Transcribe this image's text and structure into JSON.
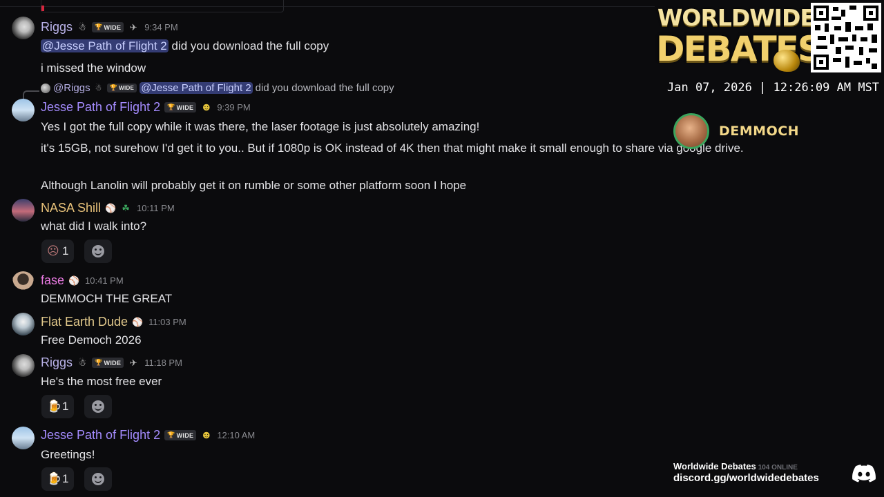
{
  "messages": {
    "m1": {
      "author": "Riggs",
      "time": "9:34 PM",
      "badge": "WIDE",
      "mention": "@Jesse Path of Flight 2",
      "line1": " did you download the full copy",
      "line2": "i missed the window"
    },
    "m2": {
      "reply": {
        "author": "@Riggs",
        "badge": "WIDE",
        "mention": "@Jesse Path of Flight 2",
        "text": " did you download the full copy"
      },
      "author": "Jesse Path of Flight 2",
      "badge": "WIDE",
      "time": "9:39 PM",
      "line1": "Yes I got the full copy while it was there, the laser footage is just absolutely amazing!",
      "line2": "it's 15GB, not surehow I'd get it to you.. But if 1080p is OK instead of 4K then that might make it small enough to share via google drive.",
      "line3": "Although Lanolin will probably get it on rumble or some other platform soon I hope"
    },
    "m3": {
      "author": "NASA Shill",
      "time": "10:11 PM",
      "text": "what did I walk into?",
      "reaction_count": "1"
    },
    "m4": {
      "author": "fase",
      "time": "10:41 PM",
      "text": "DEMMOCH THE GREAT"
    },
    "m5": {
      "author": "Flat Earth Dude",
      "time": "11:03 PM",
      "text": "Free Democh 2026"
    },
    "m6": {
      "author": "Riggs",
      "badge": "WIDE",
      "time": "11:18 PM",
      "text": "He's the most free ever",
      "reaction_count": "1"
    },
    "m7": {
      "author": "Jesse Path of Flight 2",
      "badge": "WIDE",
      "time": "12:10 AM",
      "text": "Greetings!",
      "reaction_count": "1"
    }
  },
  "overlay": {
    "brand_line1": "WORLDWIDE",
    "brand_line2": "DEBATES",
    "clock": "Jan 07, 2026 | 12:26:09 AM MST",
    "speaker": "DEMMOCH",
    "footer_server": "Worldwide Debates",
    "footer_online": "104 ONLINE",
    "footer_invite": "discord.gg/worldwidedebates"
  },
  "colors": {
    "riggs": "#b9b2e8",
    "jesse": "#a58cff",
    "nasa": "#e8c27a",
    "fase": "#e879e0",
    "flat": "#e2c98c",
    "accent_gold": "#f1d06d",
    "online_green": "#3ba55d"
  },
  "icons": [
    "snowman-icon",
    "trophy-icon",
    "cannon-icon",
    "skull-icon",
    "bat-icon",
    "shamrock-icon",
    "beer-icon",
    "add-reaction-icon",
    "discord-icon"
  ]
}
